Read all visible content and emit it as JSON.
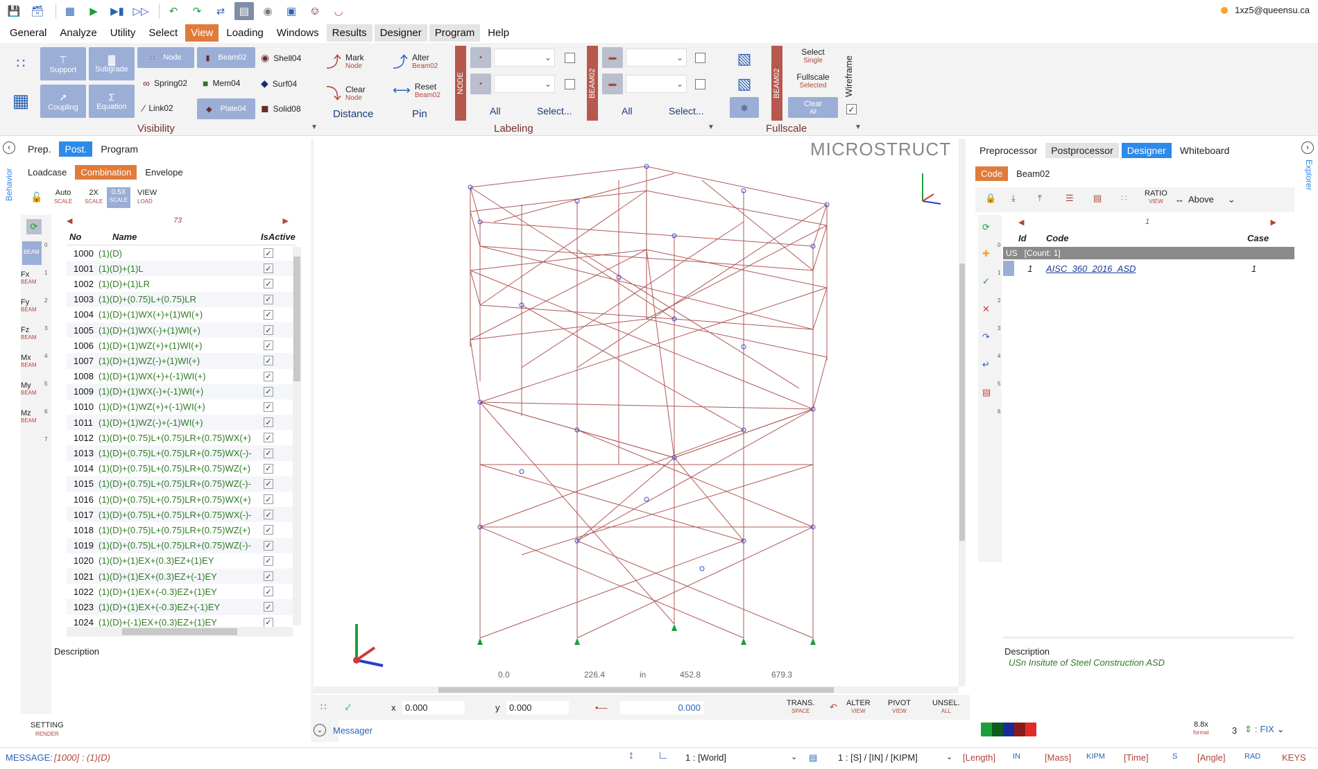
{
  "user": {
    "email": "1xz5@queensu.ca"
  },
  "menu": [
    "General",
    "Analyze",
    "Utility",
    "Select",
    "View",
    "Loading",
    "Windows",
    "Results",
    "Designer",
    "Program",
    "Help"
  ],
  "ribbon": {
    "support": "Support",
    "subgrade": "Subgrade",
    "coupling": "Coupling",
    "equation": "Equation",
    "node": "Node",
    "beam02": "Beam02",
    "shell04": "Shell04",
    "spring02": "Spring02",
    "mem04": "Mem04",
    "surf04": "Surf04",
    "link02": "Link02",
    "plate04": "Plate04",
    "solid08": "Solid08",
    "visibility": "Visibility",
    "mark": "Mark",
    "mark_sub": "Node",
    "alter": "Alter",
    "alter_sub": "Beam02",
    "clear": "Clear",
    "clear_sub": "Node",
    "reset": "Reset",
    "reset_sub": "Beam02",
    "distance": "Distance",
    "pin": "Pin",
    "node_vert": "NODE",
    "beam_vert": "BEAM02",
    "all1": "All",
    "select1": "Select...",
    "all2": "All",
    "select2": "Select...",
    "labeling": "Labeling",
    "beam_vert2": "BEAM02",
    "sel_single": "Select",
    "sel_single_sub": "Single",
    "fullscale_sel": "Fullscale",
    "fullscale_sel_sub": "Selected",
    "clear_all": "Clear",
    "clear_all_sub": "All",
    "wireframe": "Wireframe",
    "fullscale": "Fullscale"
  },
  "left": {
    "tabs": [
      "Prep.",
      "Post.",
      "Program"
    ],
    "subtabs": [
      "Loadcase",
      "Combination",
      "Envelope"
    ],
    "behavior": "Behavior",
    "auto": "Auto",
    "auto_sub": "SCALE",
    "x2": "2X",
    "x2_sub": "SCALE",
    "x05": "0.5X",
    "x05_sub": "SCALE",
    "view": "VIEW",
    "view_sub": "LOAD",
    "page": "73",
    "side": [
      {
        "label": "",
        "sub": "BEAM"
      },
      {
        "label": "Fx",
        "sub": "BEAM"
      },
      {
        "label": "Fy",
        "sub": "BEAM"
      },
      {
        "label": "Fz",
        "sub": "BEAM"
      },
      {
        "label": "Mx",
        "sub": "BEAM"
      },
      {
        "label": "My",
        "sub": "BEAM"
      },
      {
        "label": "Mz",
        "sub": "BEAM"
      }
    ],
    "sidenums": [
      "0",
      "1",
      "2",
      "3",
      "4",
      "5",
      "6",
      "7"
    ],
    "cols": [
      "No",
      "Name",
      "IsActive"
    ],
    "rows": [
      [
        "1000",
        "(1)(D)"
      ],
      [
        "1001",
        "(1)(D)+(1)L"
      ],
      [
        "1002",
        "(1)(D)+(1)LR"
      ],
      [
        "1003",
        "(1)(D)+(0.75)L+(0.75)LR"
      ],
      [
        "1004",
        "(1)(D)+(1)WX(+)+(1)WI(+)"
      ],
      [
        "1005",
        "(1)(D)+(1)WX(-)+(1)WI(+)"
      ],
      [
        "1006",
        "(1)(D)+(1)WZ(+)+(1)WI(+)"
      ],
      [
        "1007",
        "(1)(D)+(1)WZ(-)+(1)WI(+)"
      ],
      [
        "1008",
        "(1)(D)+(1)WX(+)+(-1)WI(+)"
      ],
      [
        "1009",
        "(1)(D)+(1)WX(-)+(-1)WI(+)"
      ],
      [
        "1010",
        "(1)(D)+(1)WZ(+)+(-1)WI(+)"
      ],
      [
        "1011",
        "(1)(D)+(1)WZ(-)+(-1)WI(+)"
      ],
      [
        "1012",
        "(1)(D)+(0.75)L+(0.75)LR+(0.75)WX(+)"
      ],
      [
        "1013",
        "(1)(D)+(0.75)L+(0.75)LR+(0.75)WX(-)-"
      ],
      [
        "1014",
        "(1)(D)+(0.75)L+(0.75)LR+(0.75)WZ(+)"
      ],
      [
        "1015",
        "(1)(D)+(0.75)L+(0.75)LR+(0.75)WZ(-)-"
      ],
      [
        "1016",
        "(1)(D)+(0.75)L+(0.75)LR+(0.75)WX(+)"
      ],
      [
        "1017",
        "(1)(D)+(0.75)L+(0.75)LR+(0.75)WX(-)-"
      ],
      [
        "1018",
        "(1)(D)+(0.75)L+(0.75)LR+(0.75)WZ(+)"
      ],
      [
        "1019",
        "(1)(D)+(0.75)L+(0.75)LR+(0.75)WZ(-)-"
      ],
      [
        "1020",
        "(1)(D)+(1)EX+(0.3)EZ+(1)EY"
      ],
      [
        "1021",
        "(1)(D)+(1)EX+(0.3)EZ+(-1)EY"
      ],
      [
        "1022",
        "(1)(D)+(1)EX+(-0.3)EZ+(1)EY"
      ],
      [
        "1023",
        "(1)(D)+(1)EX+(-0.3)EZ+(-1)EY"
      ],
      [
        "1024",
        "(1)(D)+(-1)EX+(0.3)EZ+(1)EY"
      ]
    ],
    "description": "Description",
    "setting": "SETTING",
    "setting_sub": "RENDER"
  },
  "viewport": {
    "brand": "MICROSTRUCT",
    "ruler": [
      "0.0",
      "226.4",
      "in",
      "452.8",
      "679.3"
    ],
    "x_label": "x",
    "x_val": "0.000",
    "y_label": "y",
    "y_val": "0.000",
    "d_val": "0.000",
    "trans": "TRANS.",
    "trans_sub": "SPACE",
    "alter": "ALTER",
    "alter_sub": "VIEW",
    "pivot": "PIVOT",
    "pivot_sub": "VIEW",
    "unsel": "UNSEL.",
    "unsel_sub": "ALL",
    "messager": "Messager"
  },
  "right": {
    "tabs": [
      "Preprocessor",
      "Postprocessor",
      "Designer",
      "Whiteboard"
    ],
    "explorer": "Explorer",
    "subtabs": [
      "Code",
      "Beam02"
    ],
    "ratio": "RATIO",
    "ratio_sub": "VIEW",
    "above": "Above",
    "page": "1",
    "cols": [
      "Id",
      "Code",
      "Case"
    ],
    "group": "US   [Count: 1]",
    "row": {
      "id": "1",
      "code": "AISC_360_2016_ASD",
      "case": "1"
    },
    "sidenums": [
      "0",
      "1",
      "2",
      "3",
      "4",
      "5",
      "6"
    ],
    "description": "Description",
    "desc_text": "USn Insitute of Steel Construction ASD",
    "format": "8.8x",
    "format_sub": "format",
    "digits": "3",
    "fix": "FIX"
  },
  "status": {
    "message_label": "MESSAGE:",
    "message": "[1000] : (1)(D)",
    "world": "1 : [World]",
    "units": "1 : [S] / [IN] / [KIPM]",
    "length": "[Length]",
    "length_u": "IN",
    "mass": "[Mass]",
    "mass_u": "KIPM",
    "time": "[Time]",
    "time_u": "S",
    "angle": "[Angle]",
    "angle_u": "RAD",
    "keys": "KEYS"
  },
  "colors": {
    "accent": "#e07b39",
    "blue": "#2d8ae8",
    "red": "#b0463a"
  }
}
